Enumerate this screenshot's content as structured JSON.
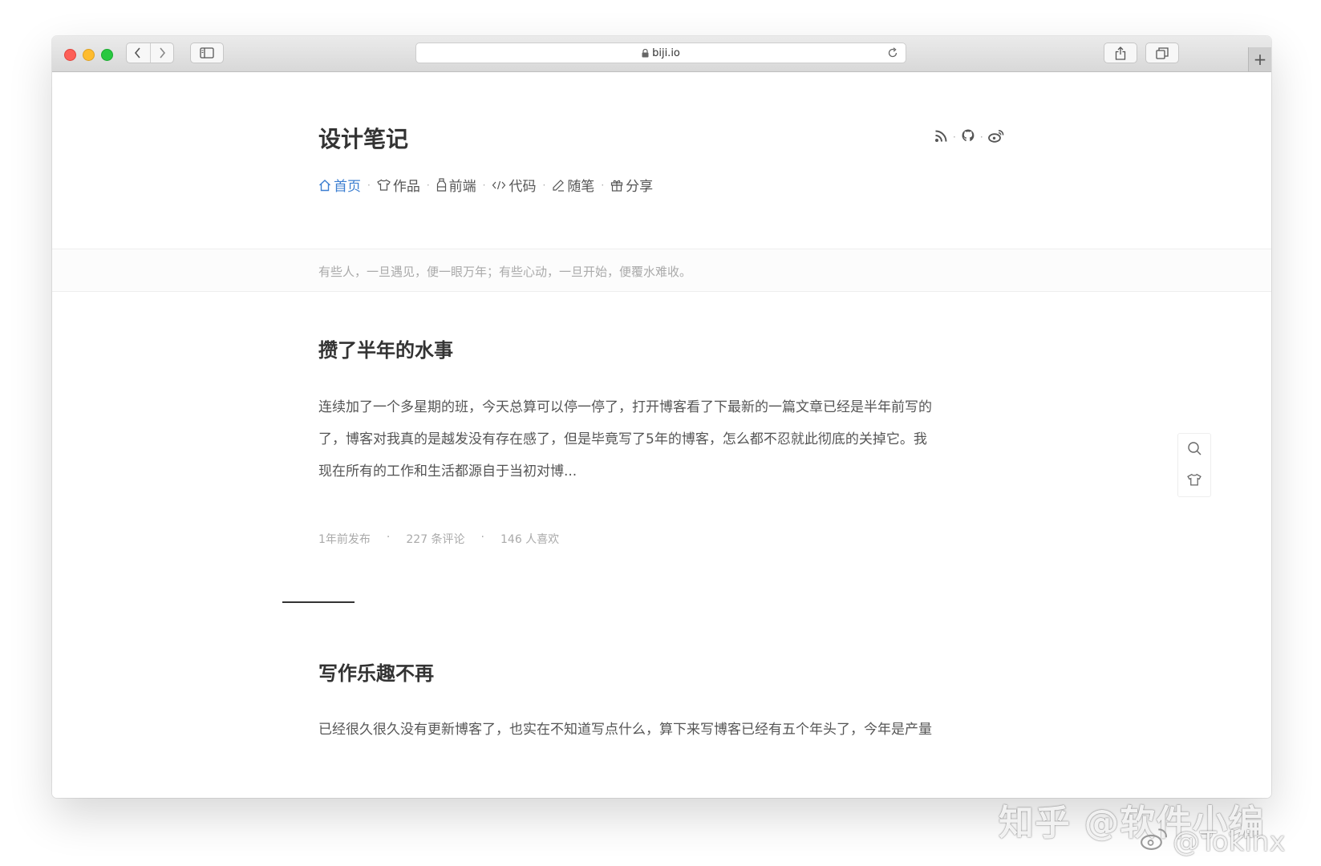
{
  "browser": {
    "url": "biji.io",
    "new_tab_label": "+"
  },
  "site": {
    "title": "设计笔记",
    "nav": [
      {
        "label": "首页",
        "icon": "home-icon",
        "active": true
      },
      {
        "label": "作品",
        "icon": "shirt-icon",
        "active": false
      },
      {
        "label": "前端",
        "icon": "bottle-icon",
        "active": false
      },
      {
        "label": "代码",
        "icon": "code-icon",
        "active": false
      },
      {
        "label": "随笔",
        "icon": "pen-icon",
        "active": false
      },
      {
        "label": "分享",
        "icon": "gift-icon",
        "active": false
      }
    ],
    "social_icons": [
      "rss-icon",
      "github-icon",
      "weibo-icon"
    ],
    "quote": "有些人，一旦遇见，便一眼万年；有些心动，一旦开始，便覆水难收。"
  },
  "posts": [
    {
      "title": "攒了半年的水事",
      "excerpt_lines": [
        "连续加了一个多星期的班，今天总算可以停一停了，打开博客看了下最新的一篇文章已经是半年前写的",
        "了，博客对我真的是越发没有存在感了，但是毕竟写了5年的博客，怎么都不忍就此彻底的关掉它。我",
        "现在所有的工作和生活都源自于当初对博..."
      ],
      "published": "1年前发布",
      "comments": "227 条评论",
      "likes": "146 人喜欢"
    },
    {
      "title": "写作乐趣不再",
      "excerpt_lines": [
        "已经很久很久没有更新博客了，也实在不知道写点什么，算下来写博客已经有五个年头了，今年是产量"
      ]
    }
  ],
  "meta_separator": "·",
  "watermark": {
    "line1": "知乎 @软件小编",
    "line2": "@Tokinx"
  },
  "colors": {
    "accent": "#3d7fd1",
    "text": "#333333",
    "muted": "#aaaaaa"
  }
}
